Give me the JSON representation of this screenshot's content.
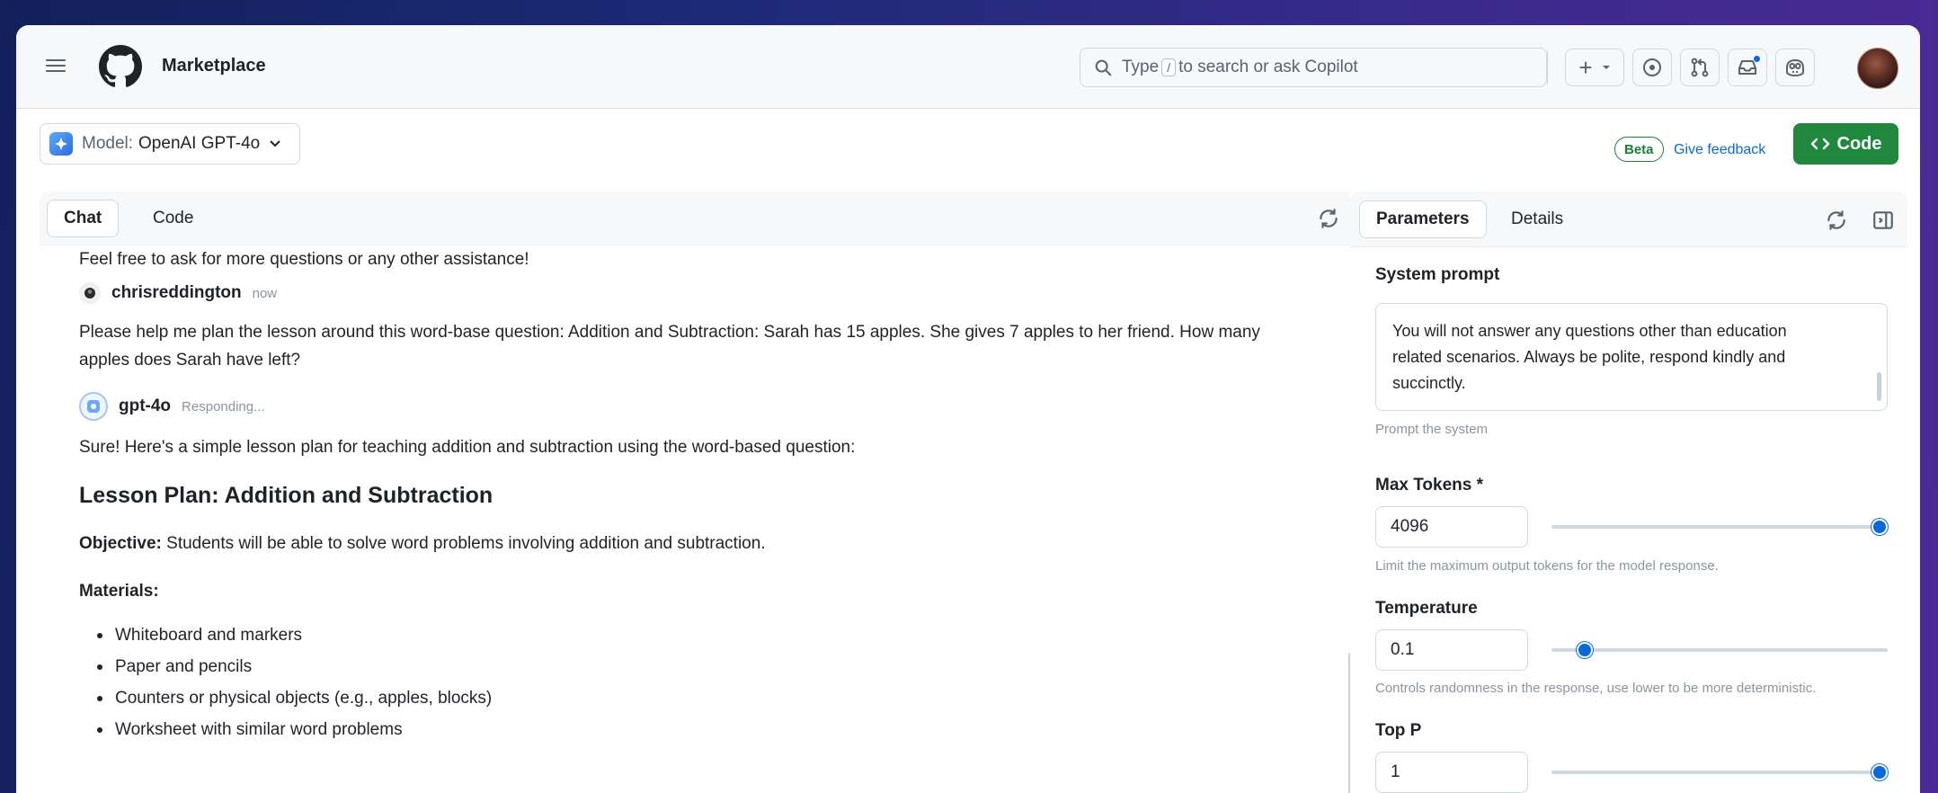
{
  "header": {
    "brand": "Marketplace",
    "search_prefix": "Type",
    "search_key": "/",
    "search_suffix": "to search or ask Copilot",
    "plus_label": "+"
  },
  "model_bar": {
    "model_label": "Model:",
    "model_name": "OpenAI GPT-4o",
    "beta": "Beta",
    "feedback": "Give feedback",
    "code_button": "Code"
  },
  "chat": {
    "tabs": [
      {
        "label": "Chat",
        "active": true
      },
      {
        "label": "Code",
        "active": false
      }
    ],
    "intro_line": "Feel free to ask for more questions or any other assistance!",
    "user": {
      "name": "chrisreddington",
      "time": "now",
      "message_line1": "Please help me plan the lesson around this word-base question: Addition and Subtraction: Sarah has 15 apples. She gives 7 apples to her friend. How many",
      "message_line2": "apples does Sarah have left?"
    },
    "bot": {
      "name": "gpt-4o",
      "status": "Responding...",
      "reply_intro": "Sure! Here's a simple lesson plan for teaching addition and subtraction using the word-based question:",
      "heading": "Lesson Plan: Addition and Subtraction",
      "objective_label": "Objective:",
      "objective_text": "Students will be able to solve word problems involving addition and subtraction.",
      "materials_label": "Materials:",
      "materials": [
        "Whiteboard and markers",
        "Paper and pencils",
        "Counters or physical objects (e.g., apples, blocks)",
        "Worksheet with similar word problems"
      ]
    }
  },
  "params": {
    "tabs": [
      {
        "label": "Parameters",
        "active": true
      },
      {
        "label": "Details",
        "active": false
      }
    ],
    "system_prompt_label": "System prompt",
    "system_prompt_lines": [
      "You will not answer any questions other than education",
      "related scenarios. Always be polite, respond kindly and",
      "succinctly."
    ],
    "system_prompt_help": "Prompt the system",
    "max_tokens": {
      "label": "Max Tokens *",
      "value": "4096",
      "slider_fraction": 1.0,
      "help": "Limit the maximum output tokens for the model response."
    },
    "temperature": {
      "label": "Temperature",
      "value": "0.1",
      "slider_fraction": 0.1,
      "help": "Controls randomness in the response, use lower to be more deterministic."
    },
    "top_p": {
      "label": "Top P",
      "value": "1",
      "slider_fraction": 1.0
    }
  },
  "colors": {
    "accent_blue": "#0969da",
    "primary_green": "#1f883d",
    "beta_green": "#1a7f37"
  },
  "icons": [
    "hamburger-icon",
    "github-logo",
    "search-icon",
    "plus-icon",
    "copilot-icon",
    "pull-request-icon",
    "inbox-icon",
    "copilot-chat-icon",
    "refresh-icon",
    "sidebar-toggle-icon"
  ]
}
